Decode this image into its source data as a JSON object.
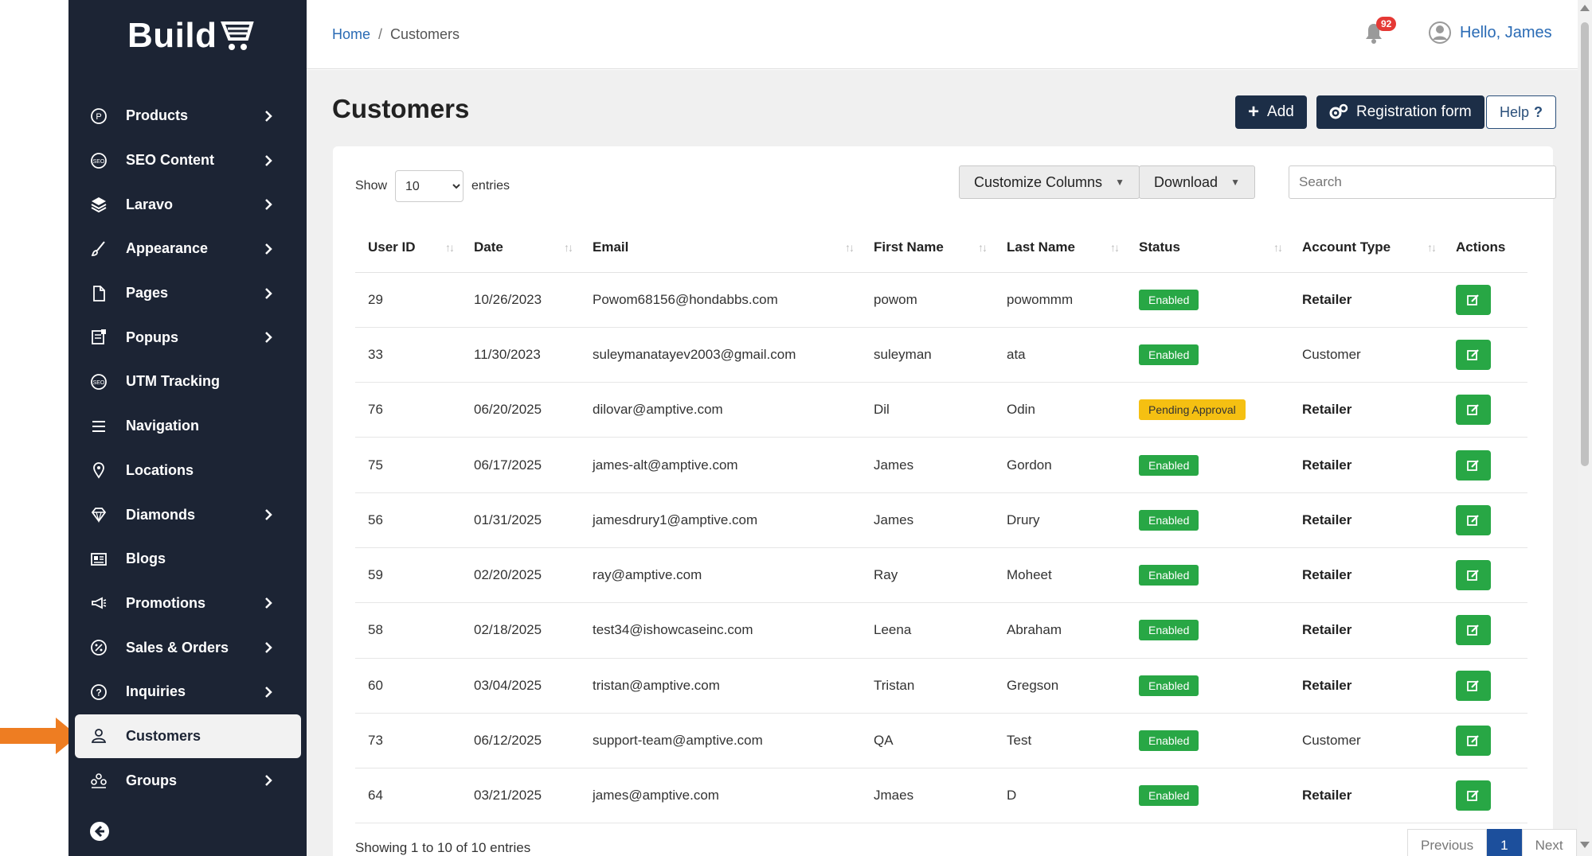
{
  "brand": {
    "name": "Build"
  },
  "sidebar": {
    "items": [
      {
        "label": "Products",
        "icon": "product-circle-icon",
        "chevron": true
      },
      {
        "label": "SEO Content",
        "icon": "seo-icon",
        "chevron": true
      },
      {
        "label": "Laravo",
        "icon": "layers-icon",
        "chevron": true
      },
      {
        "label": "Appearance",
        "icon": "brush-icon",
        "chevron": true
      },
      {
        "label": "Pages",
        "icon": "page-icon",
        "chevron": true
      },
      {
        "label": "Popups",
        "icon": "popup-icon",
        "chevron": true
      },
      {
        "label": "UTM Tracking",
        "icon": "seo-icon",
        "chevron": false
      },
      {
        "label": "Navigation",
        "icon": "menu-icon",
        "chevron": false
      },
      {
        "label": "Locations",
        "icon": "location-pin-icon",
        "chevron": false
      },
      {
        "label": "Diamonds",
        "icon": "diamond-icon",
        "chevron": true
      },
      {
        "label": "Blogs",
        "icon": "newspaper-icon",
        "chevron": false
      },
      {
        "label": "Promotions",
        "icon": "megaphone-icon",
        "chevron": true
      },
      {
        "label": "Sales & Orders",
        "icon": "percent-badge-icon",
        "chevron": true
      },
      {
        "label": "Inquiries",
        "icon": "question-circle-icon",
        "chevron": true
      },
      {
        "label": "Customers",
        "icon": "user-icon",
        "chevron": false,
        "active": true
      },
      {
        "label": "Groups",
        "icon": "group-icon",
        "chevron": true
      }
    ]
  },
  "header": {
    "breadcrumb": {
      "home": "Home",
      "separator": "/",
      "current": "Customers"
    },
    "notifications_count": "92",
    "greeting": "Hello, James"
  },
  "page": {
    "title": "Customers",
    "add_label": "Add",
    "registration_label": "Registration form",
    "help_label": "Help",
    "help_suffix": "?"
  },
  "table_controls": {
    "show_label": "Show",
    "entries_label": "entries",
    "page_size": "10",
    "customize_label": "Customize Columns",
    "download_label": "Download",
    "search_placeholder": "Search"
  },
  "table": {
    "columns": [
      "User ID",
      "Date",
      "Email",
      "First Name",
      "Last Name",
      "Status",
      "Account Type",
      "Actions"
    ],
    "rows": [
      {
        "id": "29",
        "date": "10/26/2023",
        "email": "Powom68156@hondabbs.com",
        "first": "powom",
        "last": "powommm",
        "status": "Enabled",
        "account": "Retailer"
      },
      {
        "id": "33",
        "date": "11/30/2023",
        "email": "suleymanatayev2003@gmail.com",
        "first": "suleyman",
        "last": "ata",
        "status": "Enabled",
        "account": "Customer"
      },
      {
        "id": "76",
        "date": "06/20/2025",
        "email": "dilovar@amptive.com",
        "first": "Dil",
        "last": "Odin",
        "status": "Pending Approval",
        "account": "Retailer"
      },
      {
        "id": "75",
        "date": "06/17/2025",
        "email": "james-alt@amptive.com",
        "first": "James",
        "last": "Gordon",
        "status": "Enabled",
        "account": "Retailer"
      },
      {
        "id": "56",
        "date": "01/31/2025",
        "email": "jamesdrury1@amptive.com",
        "first": "James",
        "last": "Drury",
        "status": "Enabled",
        "account": "Retailer"
      },
      {
        "id": "59",
        "date": "02/20/2025",
        "email": "ray@amptive.com",
        "first": "Ray",
        "last": "Moheet",
        "status": "Enabled",
        "account": "Retailer"
      },
      {
        "id": "58",
        "date": "02/18/2025",
        "email": "test34@ishowcaseinc.com",
        "first": "Leena",
        "last": "Abraham",
        "status": "Enabled",
        "account": "Retailer"
      },
      {
        "id": "60",
        "date": "03/04/2025",
        "email": "tristan@amptive.com",
        "first": "Tristan",
        "last": "Gregson",
        "status": "Enabled",
        "account": "Retailer"
      },
      {
        "id": "73",
        "date": "06/12/2025",
        "email": "support-team@amptive.com",
        "first": "QA",
        "last": "Test",
        "status": "Enabled",
        "account": "Customer"
      },
      {
        "id": "64",
        "date": "03/21/2025",
        "email": "james@amptive.com",
        "first": "Jmaes",
        "last": "D",
        "status": "Enabled",
        "account": "Retailer"
      }
    ]
  },
  "footer": {
    "info": "Showing 1 to 10 of 10 entries",
    "previous": "Previous",
    "current_page": "1",
    "next": "Next"
  },
  "colors": {
    "sidebar_bg": "#1c2434",
    "primary_dark": "#1c2e47",
    "enabled_green": "#28a745",
    "pending_yellow": "#f5c012",
    "arrow_orange": "#ee7d22",
    "link_blue": "#2a6bb5"
  }
}
